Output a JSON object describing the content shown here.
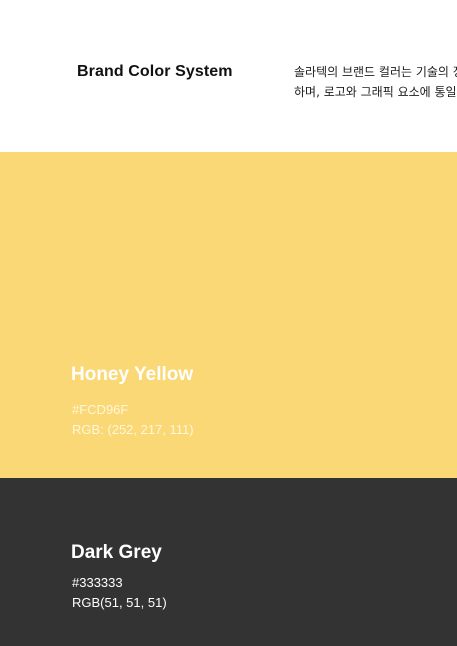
{
  "header": {
    "title": "Brand Color System",
    "description_lines": [
      "솔라텍의 브랜드 컬러는 기술의 정",
      "하며, 로고와 그래픽 요소에 통일"
    ]
  },
  "colors": [
    {
      "name": "Honey Yellow",
      "hex": "#FCD96F",
      "rgb": "RGB: (252, 217, 111)",
      "swatch_color": "#FAD875"
    },
    {
      "name": "Dark Grey",
      "hex": "#333333",
      "rgb": "RGB(51, 51, 51)",
      "swatch_color": "#333333"
    }
  ]
}
